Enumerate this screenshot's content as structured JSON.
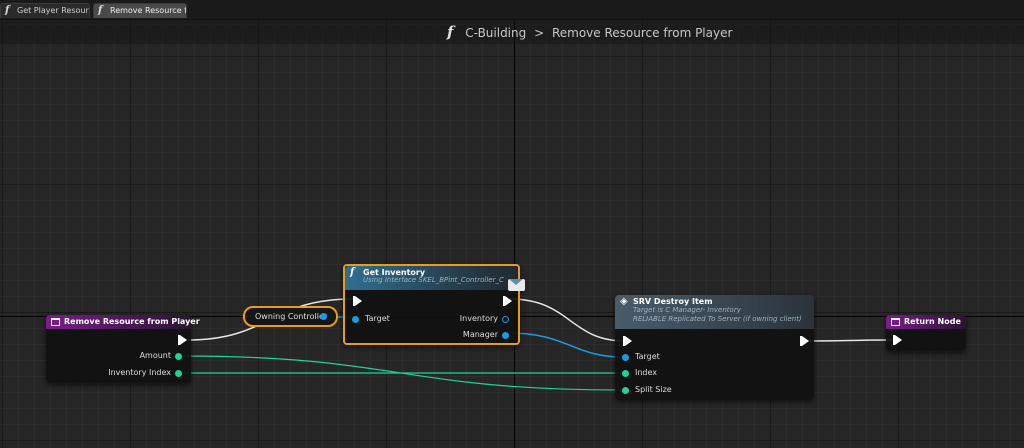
{
  "tabs": [
    {
      "label": "Get Player Resourc",
      "active": false
    },
    {
      "label": "Remove Resource f",
      "active": true
    }
  ],
  "breadcrumb": {
    "icon": "function-icon",
    "parent": "C-Building",
    "separator": ">",
    "current": "Remove Resource from Player"
  },
  "nodes": {
    "entry": {
      "title": "Remove Resource from Player",
      "pins": {
        "amount": "Amount",
        "inventory_index": "Inventory Index"
      }
    },
    "owning_controller": {
      "label": "Owning Controller"
    },
    "get_inventory": {
      "title": "Get Inventory",
      "subtitle": "Using Interface SKEL_BPint_Controller_C",
      "pins": {
        "target": "Target",
        "inventory": "Inventory",
        "manager": "Manager"
      }
    },
    "srv_destroy": {
      "title": "SRV Destroy Item",
      "subtitle1": "Target is C Manager- Inventory",
      "subtitle2": "RELIABLE Replicated To Server (if owning client)",
      "pins": {
        "target": "Target",
        "index": "Index",
        "split_size": "Split Size"
      }
    },
    "return_node": {
      "title": "Return Node"
    }
  },
  "colors": {
    "exec": "#ffffff",
    "object_pin": "#1a9bde",
    "int_pin": "#1fd39d",
    "selection": "#e79c1c",
    "event_header": "#7a1e8a"
  }
}
